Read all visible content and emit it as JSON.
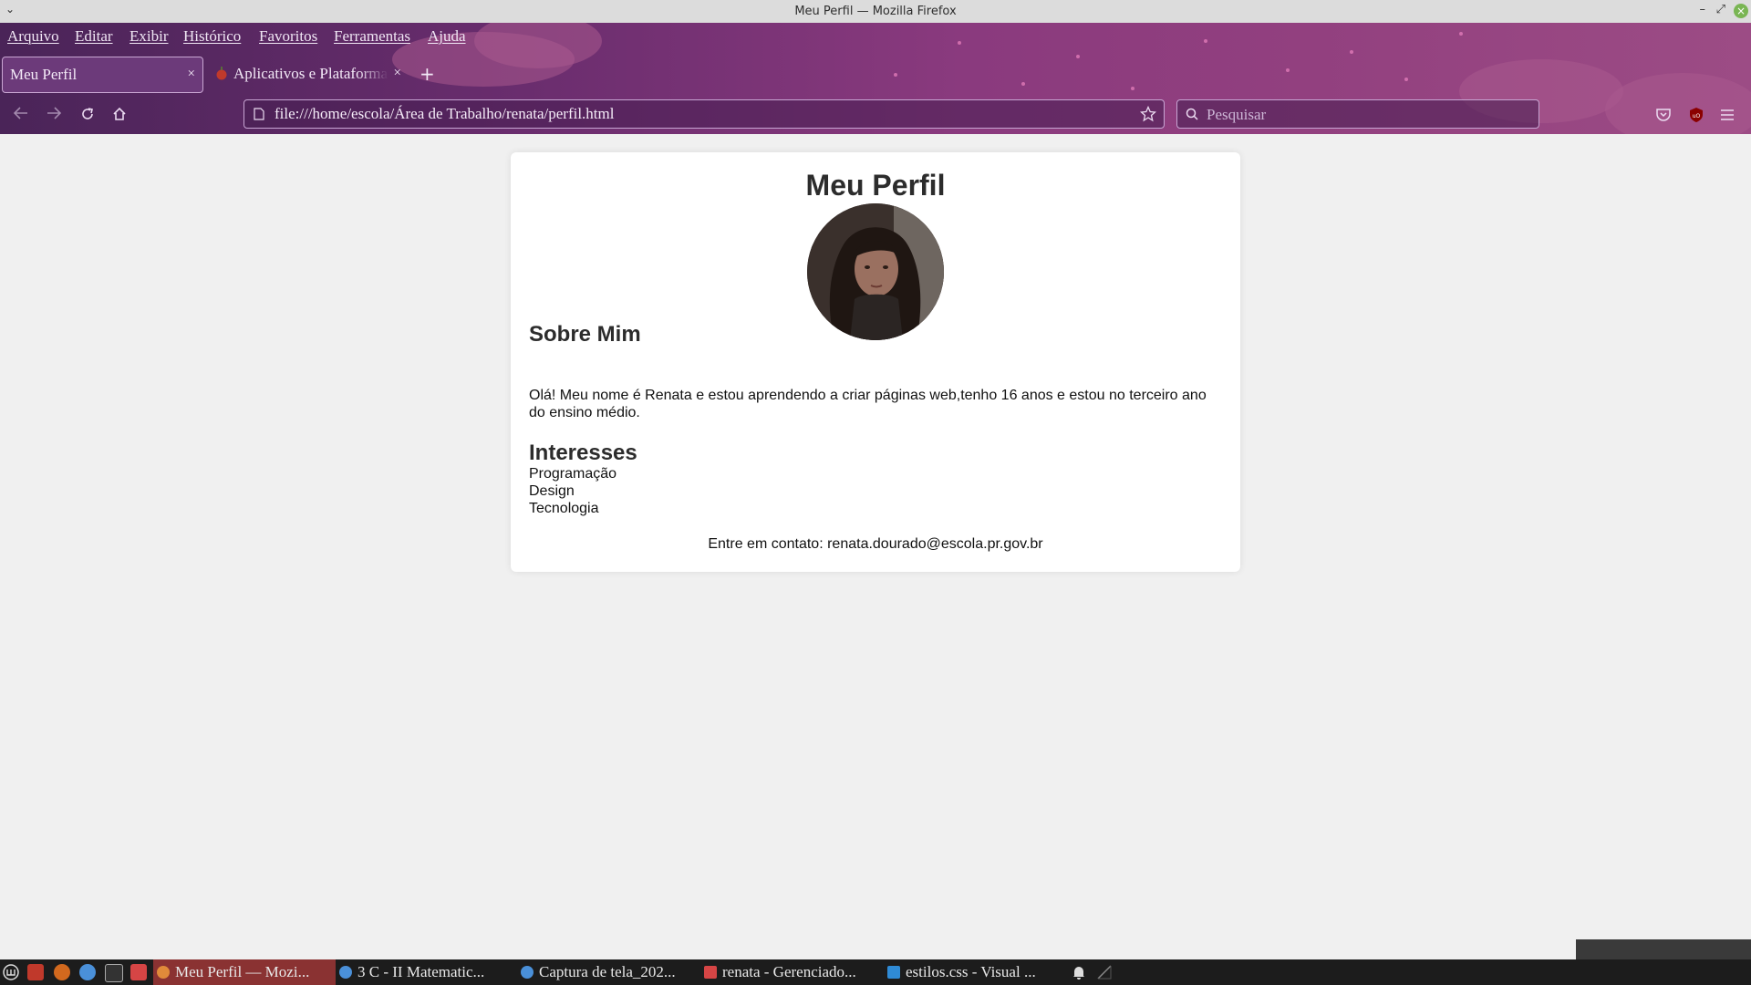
{
  "window": {
    "title": "Meu Perfil — Mozilla Firefox"
  },
  "menubar": [
    "Arquivo",
    "Editar",
    "Exibir",
    "Histórico",
    "Favoritos",
    "Ferramentas",
    "Ajuda"
  ],
  "tabs": [
    {
      "label": "Meu Perfil",
      "active": true
    },
    {
      "label": "Aplicativos e Plataformas",
      "active": false
    }
  ],
  "navbar": {
    "url": "file:///home/escola/Área de Trabalho/renata/perfil.html",
    "search_placeholder": "Pesquisar"
  },
  "page": {
    "title": "Meu Perfil",
    "about_heading": "Sobre Mim",
    "about_text": "Olá! Meu nome é Renata e estou aprendendo a criar páginas web,tenho 16 anos e estou no terceiro ano do ensino médio.",
    "interests_heading": "Interesses",
    "interests": [
      "Programação",
      "Design",
      "Tecnologia"
    ],
    "contact": "Entre em contato: renata.dourado@escola.pr.gov.br"
  },
  "taskbar": {
    "tasks": [
      {
        "label": "Meu Perfil — Mozi...",
        "icon": "firefox-icon",
        "active": true
      },
      {
        "label": "3 C - II Matematic...",
        "icon": "chrome-icon",
        "active": false
      },
      {
        "label": "Captura de tela_202...",
        "icon": "chrome-icon",
        "active": false
      },
      {
        "label": "renata - Gerenciado...",
        "icon": "folder-icon",
        "active": false
      },
      {
        "label": "estilos.css - Visual ...",
        "icon": "vscode-icon",
        "active": false
      }
    ]
  },
  "colors": {
    "theme_purple": "#6a2d6e",
    "page_background": "#f0f0f0",
    "card_background": "#ffffff",
    "active_task": "#8a3232"
  }
}
